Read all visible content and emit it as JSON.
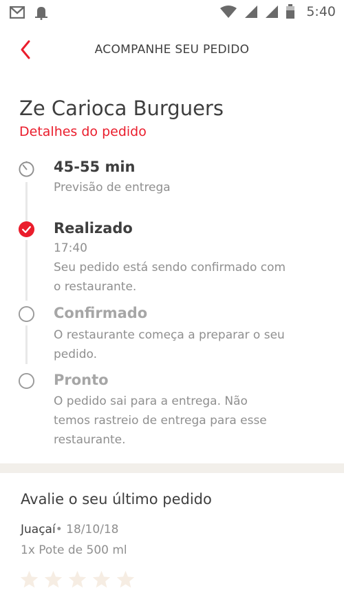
{
  "status_bar": {
    "time": "5:40",
    "icons": [
      "gmail-icon",
      "notification-icon",
      "wifi-icon",
      "signal-icon",
      "signal-icon",
      "battery-icon"
    ]
  },
  "header": {
    "title": "ACOMPANHE SEU PEDIDO",
    "back_icon": "chevron-left-icon"
  },
  "order": {
    "store_name": "Ze Carioca Burguers",
    "details_link": "Detalhes do pedido"
  },
  "timeline": {
    "estimate": {
      "title": "45-55 min",
      "subtitle": "Previsão de entrega",
      "icon": "timer-icon"
    },
    "steps": [
      {
        "title": "Realizado",
        "time": "17:40",
        "line1": "Seu pedido está sendo confirmado com",
        "line2": "o restaurante.",
        "state": "done"
      },
      {
        "title": "Confirmado",
        "line1": "O restaurante começa a preparar o seu",
        "line2": "pedido.",
        "state": "pending"
      },
      {
        "title": "Pronto",
        "line1": "O pedido sai para a entrega. Não",
        "line2": "temos rastreio de entrega para esse",
        "line3": "restaurante.",
        "state": "pending"
      }
    ]
  },
  "rating": {
    "title": "Avalie o seu último pedido",
    "store": "Juaçaí",
    "separator": "•",
    "date": "18/10/18",
    "item": "1x Pote de 500 ml",
    "stars_total": 5,
    "stars_selected": 0
  },
  "colors": {
    "accent": "#ea1d2c",
    "text": "#3e3e3e",
    "muted": "#8f8f8f",
    "line": "#e8e8e8",
    "star_empty": "#f6ede3",
    "band": "#f2efea"
  }
}
